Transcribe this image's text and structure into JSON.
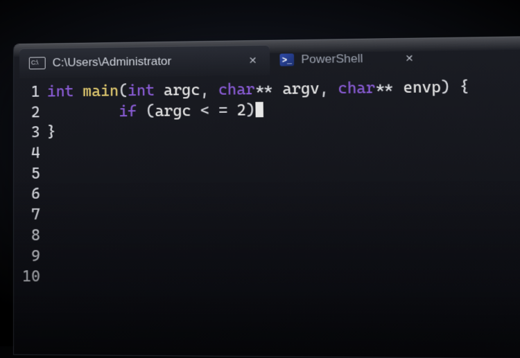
{
  "tabs": {
    "active": {
      "icon_glyph": "C:\\",
      "title": "C:\\Users\\Administrator",
      "close_glyph": "✕"
    },
    "inactive": {
      "icon_glyph": ">_",
      "title": "PowerShell",
      "close_glyph": "✕"
    }
  },
  "gutter": {
    "lines": [
      "1",
      "2",
      "3",
      "4",
      "5",
      "6",
      "7",
      "8",
      "9",
      "10"
    ]
  },
  "code": {
    "line1": {
      "kw_int": "int",
      "fn_main": "main",
      "paren_open": "(",
      "kw_int2": "int",
      "id_argc": "argc",
      "comma1": ",",
      "kw_char1": "char",
      "stars1": "**",
      "id_argv": "argv",
      "comma2": ",",
      "kw_char2": "char",
      "stars2": "**",
      "id_envp": "envp",
      "paren_close": ")",
      "brace_open": "{"
    },
    "line2": {
      "indent": "        ",
      "kw_if": "if",
      "expr_open": "(",
      "id_argc": "argc",
      "op": " < = ",
      "num": "2",
      "expr_close": ")"
    },
    "line3": {
      "brace_close": "}"
    }
  }
}
